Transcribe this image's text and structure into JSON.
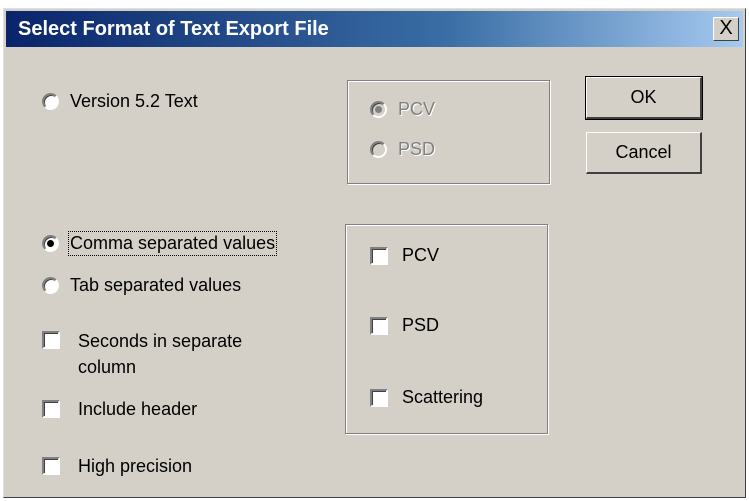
{
  "window": {
    "title": "Select Format of Text Export File",
    "close_label": "X"
  },
  "version_group": {
    "option_label": "Version 5.2 Text",
    "sub_options": [
      {
        "label": "PCV",
        "checked": true,
        "disabled": true
      },
      {
        "label": "PSD",
        "checked": false,
        "disabled": true
      }
    ]
  },
  "format_group": {
    "options": [
      {
        "label": "Comma separated values",
        "checked": true
      },
      {
        "label": "Tab separated values",
        "checked": false
      }
    ]
  },
  "options": {
    "seconds_label_line1": "Seconds in separate",
    "seconds_label_line2": "column",
    "include_header_label": "Include header",
    "high_precision_label": "High precision"
  },
  "data_types": {
    "items": [
      {
        "label": "PCV",
        "checked": false
      },
      {
        "label": "PSD",
        "checked": false
      },
      {
        "label": "Scattering",
        "checked": false
      }
    ]
  },
  "buttons": {
    "ok_label": "OK",
    "cancel_label": "Cancel"
  }
}
